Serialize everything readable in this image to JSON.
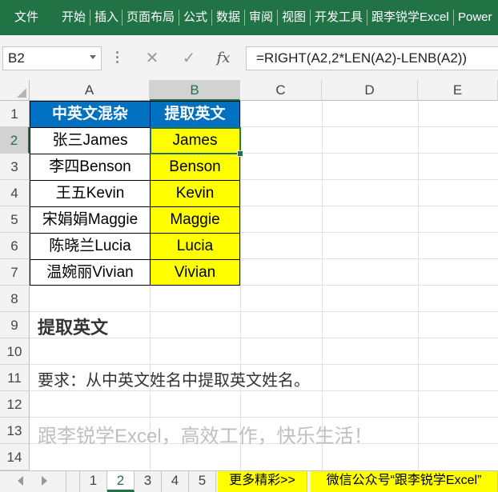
{
  "ribbon": {
    "tabs": [
      "文件",
      "开始",
      "插入",
      "页面布局",
      "公式",
      "数据",
      "审阅",
      "视图",
      "开发工具",
      "跟李锐学Excel",
      "Power"
    ]
  },
  "formula_bar": {
    "name_box": "B2",
    "cancel_icon": "✕",
    "enter_icon": "✓",
    "fx_label": "fx",
    "formula": "=RIGHT(A2,2*LEN(A2)-LENB(A2))"
  },
  "columns": [
    "A",
    "B",
    "C",
    "D",
    "E"
  ],
  "rows": [
    "1",
    "2",
    "3",
    "4",
    "5",
    "6",
    "7",
    "8",
    "9",
    "10",
    "11",
    "12",
    "13",
    "14"
  ],
  "table": {
    "headers": [
      "中英文混杂",
      "提取英文"
    ],
    "rows": [
      [
        "张三James",
        "James"
      ],
      [
        "李四Benson",
        "Benson"
      ],
      [
        "王五Kevin",
        "Kevin"
      ],
      [
        "宋娟娟Maggie",
        "Maggie"
      ],
      [
        "陈晓兰Lucia",
        "Lucia"
      ],
      [
        "温婉丽Vivian",
        "Vivian"
      ]
    ]
  },
  "notes": {
    "title": "提取英文",
    "requirement": "要求：从中英文姓名中提取英文姓名。",
    "slogan": "跟李锐学Excel，高效工作，快乐生活！"
  },
  "sheet_tabs": {
    "tabs": [
      "1",
      "2",
      "3",
      "4",
      "5"
    ],
    "active": "2",
    "more": "更多精彩>>",
    "wechat": "微信公众号“跟李锐学Excel”"
  },
  "colors": {
    "ribbon": "#217346",
    "header_fill": "#0070c0",
    "result_fill": "#ffff00",
    "slogan": "#bfbfbf"
  }
}
